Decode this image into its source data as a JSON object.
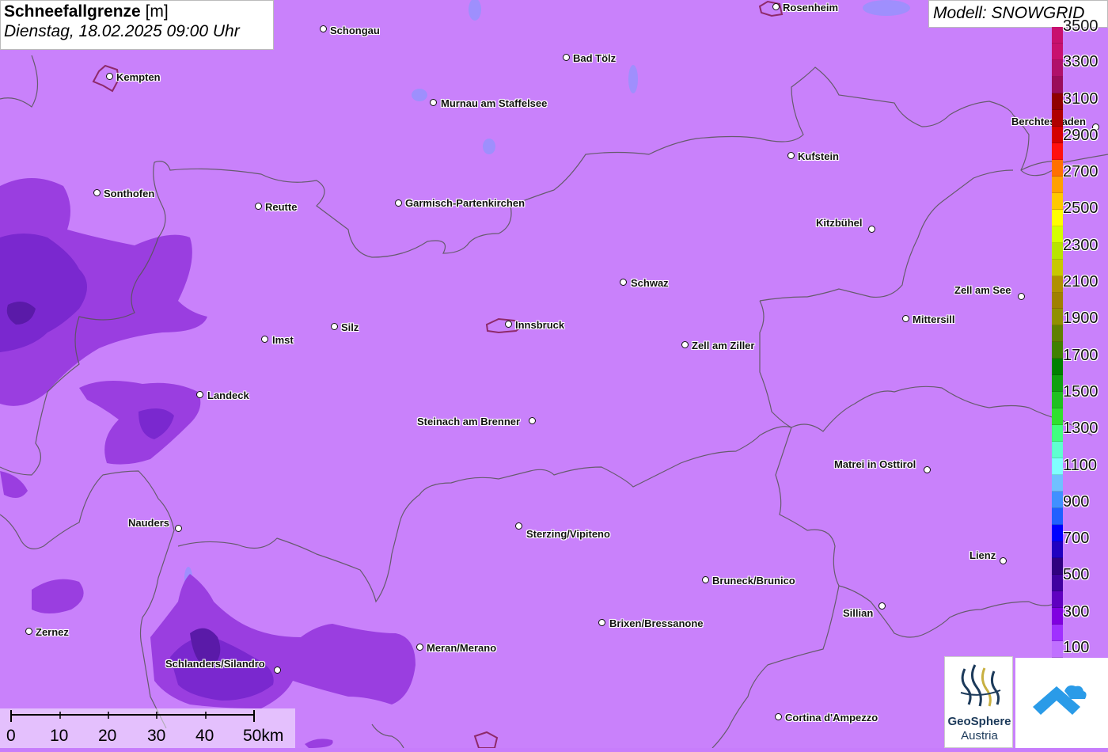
{
  "title": {
    "main": "Schneefallgrenze",
    "unit": "[m]",
    "datetime": "Dienstag, 18.02.2025 09:00 Uhr"
  },
  "model": "Modell: SNOWGRID",
  "cities": [
    {
      "name": "Rosenheim",
      "label": "Rosenheim"
    },
    {
      "name": "Schongau",
      "label": "Schongau"
    },
    {
      "name": "Kempten",
      "label": "Kempten"
    },
    {
      "name": "Bad Tölz",
      "label": "Bad Tölz"
    },
    {
      "name": "Murnau am Staffelsee",
      "label": "Murnau am Staffelsee"
    },
    {
      "name": "Berchtesgaden",
      "label": "Berchtesgaden"
    },
    {
      "name": "Kufstein",
      "label": "Kufstein"
    },
    {
      "name": "Sonthofen",
      "label": "Sonthofen"
    },
    {
      "name": "Reutte",
      "label": "Reutte"
    },
    {
      "name": "Garmisch-Partenkirchen",
      "label": "Garmisch-Partenkirchen"
    },
    {
      "name": "Kitzbühel",
      "label": "Kitzbühel"
    },
    {
      "name": "Schwaz",
      "label": "Schwaz"
    },
    {
      "name": "Zell am See",
      "label": "Zell am See"
    },
    {
      "name": "Mittersill",
      "label": "Mittersill"
    },
    {
      "name": "Silz",
      "label": "Silz"
    },
    {
      "name": "Innsbruck",
      "label": "Innsbruck"
    },
    {
      "name": "Imst",
      "label": "Imst"
    },
    {
      "name": "Zell am Ziller",
      "label": "Zell am Ziller"
    },
    {
      "name": "Landeck",
      "label": "Landeck"
    },
    {
      "name": "Steinach am Brenner",
      "label": "Steinach am Brenner"
    },
    {
      "name": "Matrei in Osttirol",
      "label": "Matrei in Osttirol"
    },
    {
      "name": "Nauders",
      "label": "Nauders"
    },
    {
      "name": "Sterzing/Vipiteno",
      "label": "Sterzing/Vipiteno"
    },
    {
      "name": "Lienz",
      "label": "Lienz"
    },
    {
      "name": "Bruneck/Brunico",
      "label": "Bruneck/Brunico"
    },
    {
      "name": "Sillian",
      "label": "Sillian"
    },
    {
      "name": "Brixen/Bressanone",
      "label": "Brixen/Bressanone"
    },
    {
      "name": "Zernez",
      "label": "Zernez"
    },
    {
      "name": "Meran/Merano",
      "label": "Meran/Merano"
    },
    {
      "name": "Schlanders/Silandro",
      "label": "Schlanders/Silandro"
    },
    {
      "name": "Cortina d'Ampezzo",
      "label": "Cortina d'Ampezzo"
    }
  ],
  "legend": {
    "labels": [
      "3500",
      "3300",
      "3100",
      "2900",
      "2700",
      "2500",
      "2300",
      "2100",
      "1900",
      "1700",
      "1500",
      "1300",
      "1100",
      "900",
      "700",
      "500",
      "300",
      "100"
    ],
    "colors": [
      "#c8106e",
      "#c8106e",
      "#b0106a",
      "#9a0c5a",
      "#900000",
      "#b00000",
      "#d40000",
      "#ff1010",
      "#ff7000",
      "#ffa000",
      "#ffc800",
      "#ffff00",
      "#d4ff00",
      "#b8e400",
      "#c8c800",
      "#b09000",
      "#a08000",
      "#909000",
      "#608000",
      "#408000",
      "#008000",
      "#10a010",
      "#20c020",
      "#30e030",
      "#40ff80",
      "#60ffd0",
      "#80ffff",
      "#70c0ff",
      "#4090ff",
      "#2060ff",
      "#0000ff",
      "#2000c0",
      "#300080",
      "#4000a0",
      "#6000c0",
      "#8000e0",
      "#a030ff",
      "#c070ff"
    ]
  },
  "scale": {
    "ticks": [
      "0",
      "10",
      "20",
      "30",
      "40",
      "50km"
    ]
  },
  "logos": {
    "geosphere_line1": "GeoSphere",
    "geosphere_line2": "Austria"
  }
}
